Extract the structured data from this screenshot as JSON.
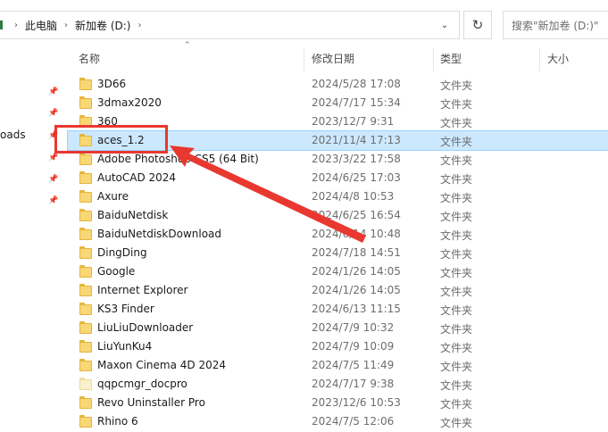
{
  "breadcrumb": {
    "items": [
      "此电脑",
      "新加卷 (D:)"
    ],
    "separator": "›"
  },
  "search": {
    "placeholder": "搜索\"新加卷 (D:)\""
  },
  "nav": {
    "partial_label": "oads"
  },
  "columns": {
    "name": "名称",
    "modified": "修改日期",
    "type": "类型",
    "size": "大小"
  },
  "files": [
    {
      "name": "3D66",
      "modified": "2024/5/28 17:08",
      "type": "文件夹"
    },
    {
      "name": "3dmax2020",
      "modified": "2024/7/17 15:34",
      "type": "文件夹"
    },
    {
      "name": "360",
      "modified": "2023/12/7 9:31",
      "type": "文件夹"
    },
    {
      "name": "aces_1.2",
      "modified": "2021/11/4 17:13",
      "type": "文件夹"
    },
    {
      "name": "Adobe Photoshop CS5 (64 Bit)",
      "modified": "2023/3/22 17:58",
      "type": "文件夹"
    },
    {
      "name": "AutoCAD 2024",
      "modified": "2024/6/25 17:03",
      "type": "文件夹"
    },
    {
      "name": "Axure",
      "modified": "2024/4/8 10:53",
      "type": "文件夹"
    },
    {
      "name": "BaiduNetdisk",
      "modified": "2024/6/25 16:54",
      "type": "文件夹"
    },
    {
      "name": "BaiduNetdiskDownload",
      "modified": "2024/6/14 10:48",
      "type": "文件夹"
    },
    {
      "name": "DingDing",
      "modified": "2024/7/18 14:51",
      "type": "文件夹"
    },
    {
      "name": "Google",
      "modified": "2024/1/26 14:05",
      "type": "文件夹"
    },
    {
      "name": "Internet Explorer",
      "modified": "2024/1/26 14:05",
      "type": "文件夹"
    },
    {
      "name": "KS3 Finder",
      "modified": "2024/6/13 11:15",
      "type": "文件夹"
    },
    {
      "name": "LiuLiuDownloader",
      "modified": "2024/7/9 10:32",
      "type": "文件夹"
    },
    {
      "name": "LiuYunKu4",
      "modified": "2024/7/9 10:09",
      "type": "文件夹"
    },
    {
      "name": "Maxon Cinema 4D 2024",
      "modified": "2024/7/5 11:49",
      "type": "文件夹"
    },
    {
      "name": "qqpcmgr_docpro",
      "modified": "2024/7/17 9:38",
      "type": "文件夹"
    },
    {
      "name": "Revo Uninstaller Pro",
      "modified": "2023/12/6 10:53",
      "type": "文件夹"
    },
    {
      "name": "Rhino 6",
      "modified": "2024/7/5 12:06",
      "type": "文件夹"
    }
  ],
  "selected_file": "aces_1.2",
  "light_folder": "qqpcmgr_docpro",
  "colors": {
    "selection": "#cce8ff",
    "annotation": "#e8382f",
    "folder": "#f8d775"
  }
}
